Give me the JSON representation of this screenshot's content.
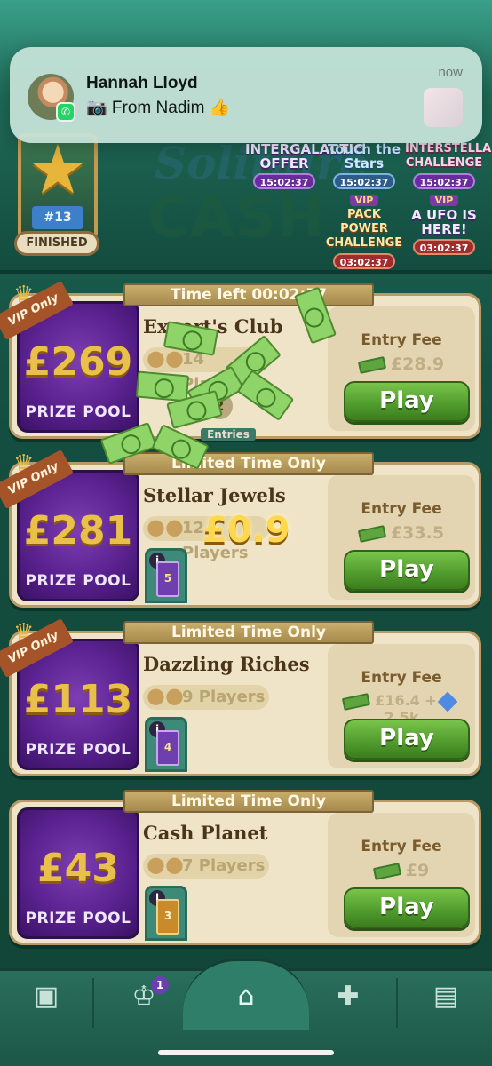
{
  "notification": {
    "sender": "Hannah Lloyd",
    "message": "📷 From Nadim 👍",
    "time": "now",
    "app_icon": "whatsapp-icon"
  },
  "header": {
    "tournament_rank": "#13",
    "tournament_status": "FINISHED",
    "logo_word1": "Solitaire",
    "logo_word2": "CASH",
    "events": [
      {
        "title": "INTERGALACTIC OFFER",
        "timer": "15:02:37"
      },
      {
        "title": "Touch the Stars",
        "timer": "15:02:37"
      },
      {
        "title": "INTERSTELLAR CHALLENGE",
        "timer": "15:02:37"
      },
      {
        "vip": "VIP",
        "title": "PACK POWER CHALLENGE",
        "timer": "03:02:37"
      },
      {
        "vip": "VIP",
        "title": "A UFO IS HERE!",
        "timer": "03:02:37"
      }
    ]
  },
  "overlay": {
    "earned": "£0.9",
    "entries_count": "2",
    "entries_label": "Entries"
  },
  "cards": [
    {
      "vip_label": "VIP Only",
      "banner": "Time left 00:02:57",
      "prize": "£269",
      "prize_label": "PRIZE POOL",
      "name": "Expert's Club",
      "players": "14 Players",
      "fee_label": "Entry Fee",
      "fee": "£28.9",
      "play": "Play"
    },
    {
      "vip_label": "VIP Only",
      "banner": "Limited Time Only",
      "prize": "£281",
      "prize_label": "PRIZE POOL",
      "name": "Stellar Jewels",
      "players": "12 Players",
      "ticket": "5",
      "fee_label": "Entry Fee",
      "fee": "£33.5",
      "play": "Play"
    },
    {
      "vip_label": "VIP Only",
      "banner": "Limited Time Only",
      "prize": "£113",
      "prize_label": "PRIZE POOL",
      "name": "Dazzling Riches",
      "players": "9 Players",
      "ticket": "4",
      "fee_label": "Entry Fee",
      "fee": "£16.4 +",
      "fee_gems": "2.5k",
      "play": "Play"
    },
    {
      "banner": "Limited Time Only",
      "prize": "£43",
      "prize_label": "PRIZE POOL",
      "name": "Cash Planet",
      "players": "7 Players",
      "ticket": "3",
      "fee_label": "Entry Fee",
      "fee": "£9",
      "play": "Play"
    }
  ],
  "bottom_nav": {
    "items": [
      "shop-icon",
      "trophy-icon",
      "home-icon",
      "gift-icon",
      "cards-icon"
    ],
    "trophy_badge": "1"
  }
}
